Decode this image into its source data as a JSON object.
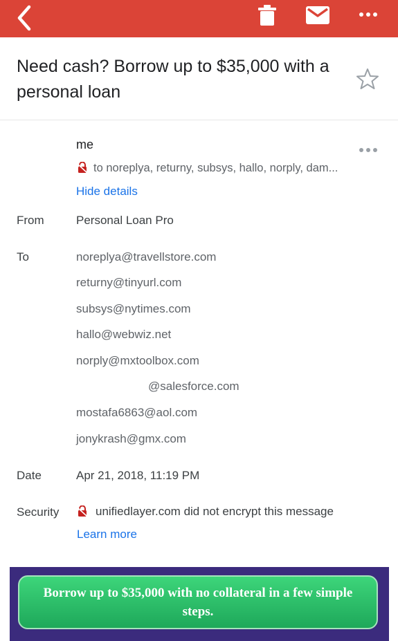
{
  "header": {
    "icons": [
      "back-arrow-icon",
      "trash-icon",
      "mail-icon",
      "more-dots-icon"
    ],
    "bar_color": "#db4437"
  },
  "email": {
    "subject": "Need cash? Borrow up to $35,000 with a personal loan",
    "sender": "me",
    "recipients_summary": "to noreplya, returny, subsys, hallo, norply, dam...",
    "hide_details": "Hide details"
  },
  "details": {
    "from_label": "From",
    "from_value": "Personal Loan Pro",
    "to_label": "To",
    "to_list": [
      "noreplya@travellstore.com",
      "returny@tinyurl.com",
      "subsys@nytimes.com",
      "hallo@webwiz.net",
      "norply@mxtoolbox.com",
      "@salesforce.com",
      "mostafa6863@aol.com",
      "jonykrash@gmx.com"
    ],
    "date_label": "Date",
    "date_value": "Apr 21, 2018, 11:19 PM",
    "security_label": "Security",
    "security_value": "unifiedlayer.com did not encrypt this message",
    "learn_more": "Learn more"
  },
  "body": {
    "cta_text": "Borrow up to $35,000 with no collateral in a few simple steps.",
    "banner_color": "#3b2b7d",
    "cta_color": "#2ebf6a"
  }
}
